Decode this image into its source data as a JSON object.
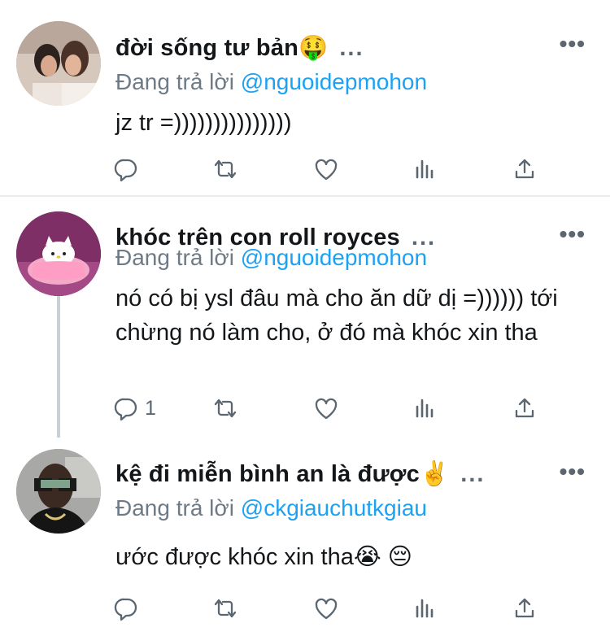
{
  "colors": {
    "handle": "#1da1f2",
    "secondary": "#6e7a85",
    "text": "#14171a"
  },
  "tweets": [
    {
      "name": "đời sống tư bản🤑",
      "ellipsis": "...",
      "reply_prefix": "Đang trả lời",
      "reply_handle": "@nguoidepmohon",
      "text": "jz tr =)))))))))))))))",
      "reply_count": "",
      "avatar_icon": "two-women-photo"
    },
    {
      "name": "khóc trên con roll royces",
      "ellipsis": "...",
      "reply_prefix": "Đang trả lời",
      "reply_handle": "@nguoidepmohon",
      "text": "nó có bị ysl đâu mà cho ăn dữ dị =)))))) tới chừng nó làm cho, ở đó mà khóc xin tha",
      "reply_count": "1",
      "avatar_icon": "hello-kitty-bed"
    },
    {
      "name": "kệ đi miễn bình an là được✌️",
      "ellipsis": "...",
      "reply_prefix": "Đang trả lời",
      "reply_handle": "@ckgiauchutkgiau",
      "text": "ước được khóc xin tha😭  😔",
      "reply_count": "",
      "avatar_icon": "money-glasses-person"
    }
  ],
  "icons": [
    "reply-icon",
    "retweet-icon",
    "like-icon",
    "analytics-icon",
    "share-icon",
    "more-icon"
  ]
}
